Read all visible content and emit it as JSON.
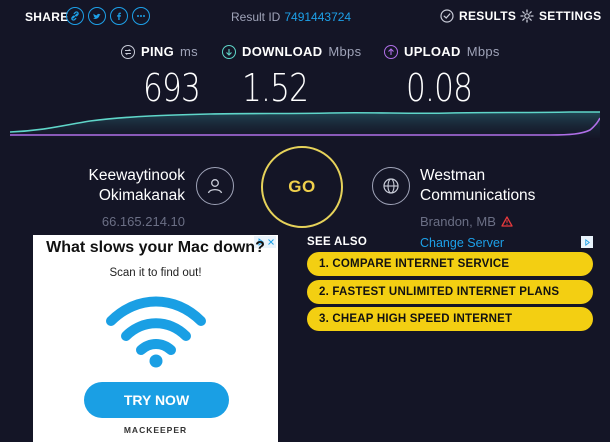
{
  "header": {
    "share_label": "SHARE",
    "share_icons": [
      "link-icon",
      "twitter-icon",
      "facebook-icon",
      "more-icon"
    ],
    "result_id_label": "Result ID",
    "result_id_value": "7491443724",
    "results_label": "RESULTS",
    "settings_label": "SETTINGS"
  },
  "metrics": {
    "ping": {
      "label": "PING",
      "unit": "ms",
      "value": "693",
      "icon": "ping-icon"
    },
    "download": {
      "label": "DOWNLOAD",
      "unit": "Mbps",
      "value": "1.52",
      "icon": "download-icon"
    },
    "upload": {
      "label": "UPLOAD",
      "unit": "Mbps",
      "value": "0.08",
      "icon": "upload-icon"
    }
  },
  "isp": {
    "name_line1": "Keewaytinook",
    "name_line2": "Okimakanak",
    "ip": "66.165.214.10"
  },
  "go_label": "GO",
  "server": {
    "name_line1": "Westman",
    "name_line2": "Communications",
    "location": "Brandon, MB",
    "change_label": "Change Server"
  },
  "ad": {
    "title": "What slows your Mac down?",
    "subtitle": "Scan it to find out!",
    "button": "TRY NOW",
    "brand": "MACKEEPER"
  },
  "see_also": {
    "heading": "SEE ALSO",
    "items": [
      "1. COMPARE INTERNET SERVICE",
      "2. FASTEST UNLIMITED INTERNET PLANS",
      "3. CHEAP HIGH SPEED INTERNET"
    ]
  },
  "colors": {
    "background": "#141526",
    "accent_blue": "#1da0e8",
    "download_line": "#5fd6c9",
    "upload_line": "#b06fe8",
    "go_yellow": "#e6d25a",
    "see_also_yellow": "#f3cf12",
    "warning_red": "#e6393c"
  }
}
